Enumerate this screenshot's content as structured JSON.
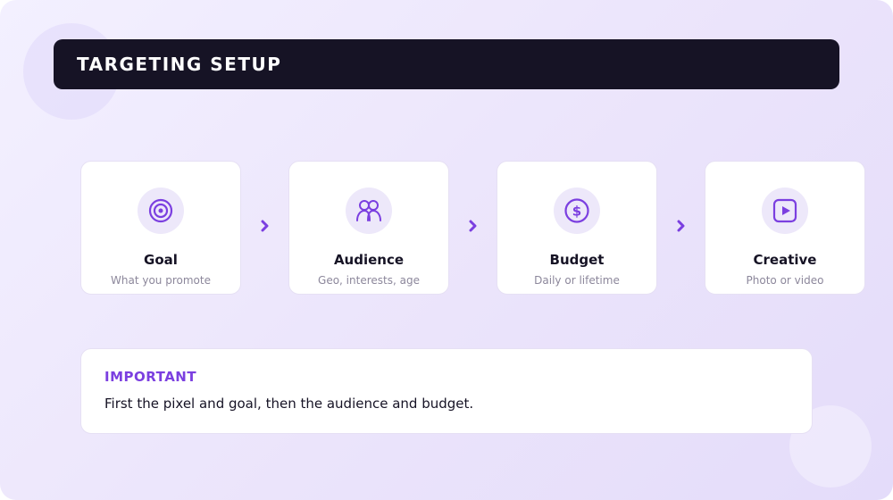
{
  "header": {
    "title": "TARGETING SETUP"
  },
  "steps": [
    {
      "title": "Goal",
      "subtitle": "What you promote",
      "icon": "target-icon"
    },
    {
      "title": "Audience",
      "subtitle": "Geo, interests, age",
      "icon": "users-icon"
    },
    {
      "title": "Budget",
      "subtitle": "Daily or lifetime",
      "icon": "dollar-icon"
    },
    {
      "title": "Creative",
      "subtitle": "Photo or video",
      "icon": "play-icon"
    }
  ],
  "note": {
    "label": "IMPORTANT",
    "text": "First the pixel and goal, then the audience and budget."
  },
  "colors": {
    "accent": "#7b3fe0",
    "header_bg": "#161325",
    "icon_bg": "#ede8fa"
  }
}
